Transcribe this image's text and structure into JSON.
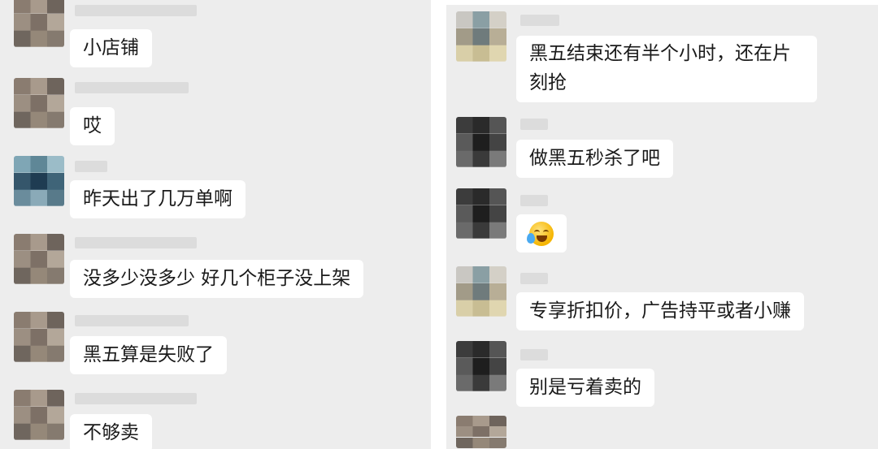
{
  "left_chat": {
    "messages": [
      {
        "text": "小店铺"
      },
      {
        "text": "哎"
      },
      {
        "text": "昨天出了几万单啊"
      },
      {
        "text": "没多少没多少  好几个柜子没上架"
      },
      {
        "text": "黑五算是失败了"
      },
      {
        "text": "不够卖"
      }
    ]
  },
  "right_chat": {
    "messages": [
      {
        "text": "黑五结束还有半个小时，还在片刻抢"
      },
      {
        "text": "做黑五秒杀了吧"
      },
      {
        "emoji": "crying-laughing-emoji"
      },
      {
        "text": "专享折扣价，广告持平或者小赚"
      },
      {
        "text": "别是亏着卖的"
      }
    ]
  },
  "colors": {
    "chat_background": "#ededed",
    "bubble_background": "#ffffff",
    "text": "#1a1a1a"
  }
}
